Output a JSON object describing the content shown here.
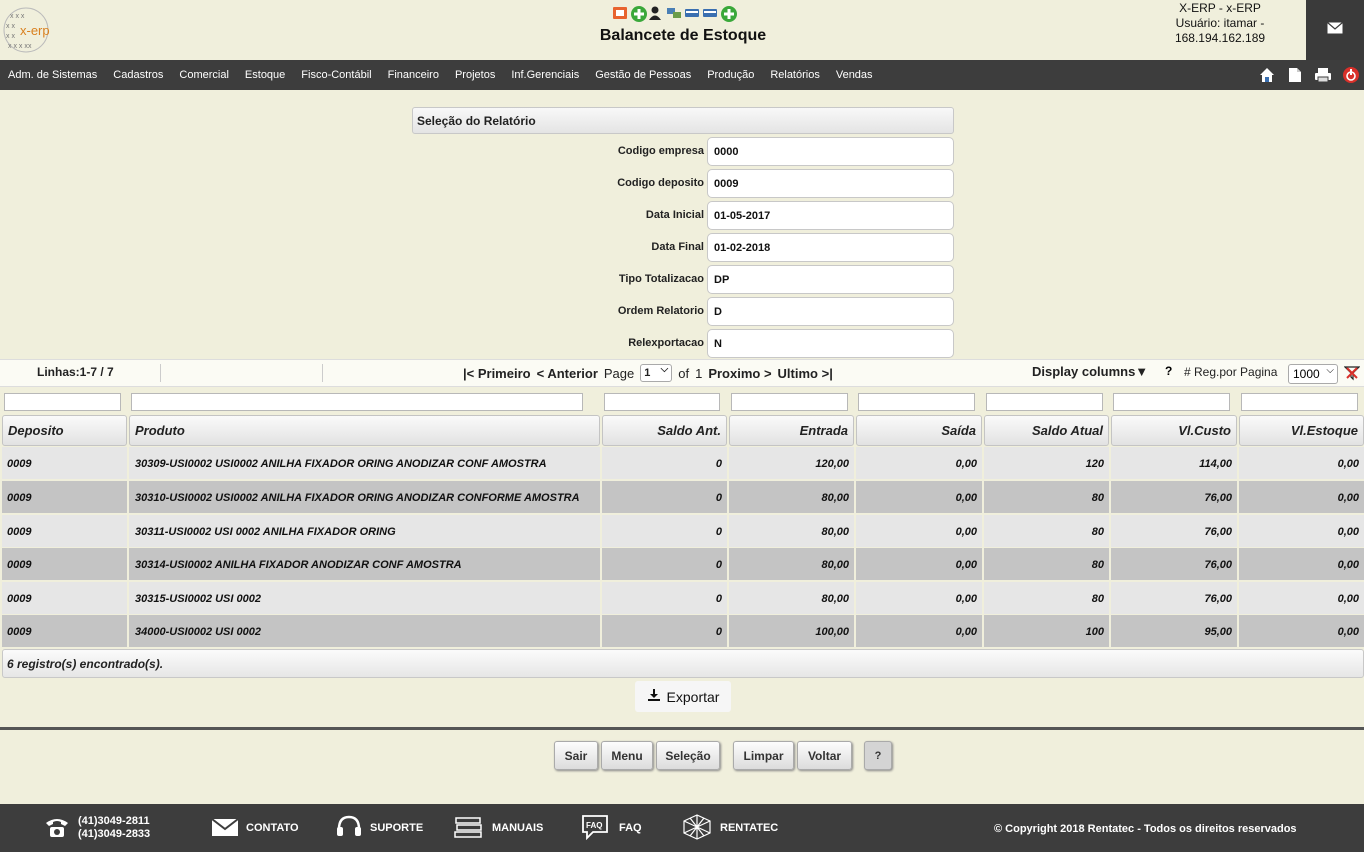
{
  "header": {
    "logo_text": "x-erp",
    "title": "Balancete de Estoque",
    "user_line1": "X-ERP - x-ERP",
    "user_line2": "Usuário: itamar -",
    "user_line3": "168.194.162.189",
    "icons": [
      "office-icon",
      "add-icon",
      "users-icon",
      "network-icon",
      "card-icon",
      "card-icon",
      "add-icon"
    ]
  },
  "menu": {
    "items": [
      "Adm. de Sistemas",
      "Cadastros",
      "Comercial",
      "Estoque",
      "Fisco-Contábil",
      "Financeiro",
      "Projetos",
      "Inf.Gerenciais",
      "Gestão de Pessoas",
      "Produção",
      "Relatórios",
      "Vendas"
    ],
    "tools": [
      "home-icon",
      "document-icon",
      "printer-icon",
      "power-icon"
    ]
  },
  "selection": {
    "title": "Seleção do Relatório",
    "fields": [
      {
        "label": "Codigo empresa",
        "value": "0000"
      },
      {
        "label": "Codigo deposito",
        "value": "0009"
      },
      {
        "label": "Data Inicial",
        "value": "01-05-2017"
      },
      {
        "label": "Data Final",
        "value": "01-02-2018"
      },
      {
        "label": "Tipo Totalizacao",
        "value": "DP"
      },
      {
        "label": "Ordem Relatorio",
        "value": "D"
      },
      {
        "label": "Relexportacao",
        "value": "N"
      }
    ]
  },
  "pager": {
    "lines": "Linhas:1-7 / 7",
    "first": "|< Primeiro",
    "prev": "< Anterior",
    "page_label": "Page",
    "page_value": "1",
    "of_label": "of",
    "total_pages": "1",
    "next": "Proximo >",
    "last": "Ultimo >|",
    "display_columns": "Display columns▼",
    "help": "?",
    "reg_label": "# Reg.por Pagina",
    "reg_value": "1000"
  },
  "table": {
    "headers": [
      "Deposito",
      "Produto",
      "Saldo Ant.",
      "Entrada",
      "Saída",
      "Saldo Atual",
      "Vl.Custo",
      "Vl.Estoque"
    ],
    "rows": [
      [
        "0009",
        "30309-USI0002 USI0002 ANILHA FIXADOR ORING ANODIZAR CONF AMOSTRA",
        "0",
        "120,00",
        "0,00",
        "120",
        "114,00",
        "0,00"
      ],
      [
        "0009",
        "30310-USI0002 USI0002 ANILHA FIXADOR ORING ANODIZAR CONFORME AMOSTRA",
        "0",
        "80,00",
        "0,00",
        "80",
        "76,00",
        "0,00"
      ],
      [
        "0009",
        "30311-USI0002 USI 0002 ANILHA FIXADOR ORING",
        "0",
        "80,00",
        "0,00",
        "80",
        "76,00",
        "0,00"
      ],
      [
        "0009",
        "30314-USI0002 ANILHA FIXADOR ANODIZAR CONF AMOSTRA",
        "0",
        "80,00",
        "0,00",
        "80",
        "76,00",
        "0,00"
      ],
      [
        "0009",
        "30315-USI0002 USI 0002",
        "0",
        "80,00",
        "0,00",
        "80",
        "76,00",
        "0,00"
      ],
      [
        "0009",
        "34000-USI0002 USI 0002",
        "0",
        "100,00",
        "0,00",
        "100",
        "95,00",
        "0,00"
      ]
    ],
    "footer": "6 registro(s) encontrado(s)."
  },
  "actions": {
    "export": "Exportar",
    "sair": "Sair",
    "menu": "Menu",
    "selecao": "Seleção",
    "limpar": "Limpar",
    "voltar": "Voltar",
    "help": "?"
  },
  "footer": {
    "phone1": "(41)3049-2811",
    "phone2": "(41)3049-2833",
    "contato": "CONTATO",
    "suporte": "SUPORTE",
    "manuais": "MANUAIS",
    "faq": "FAQ",
    "faq_icon_text": "FAQ",
    "rentatec": "RENTATEC",
    "copyright": "© Copyright 2018 Rentatec - Todos os direitos reservados"
  },
  "colors": {
    "background": "#f0efdc",
    "bar": "#3d3d3d",
    "row_light": "#e6e6e6",
    "row_dark": "#c4c4c4"
  }
}
